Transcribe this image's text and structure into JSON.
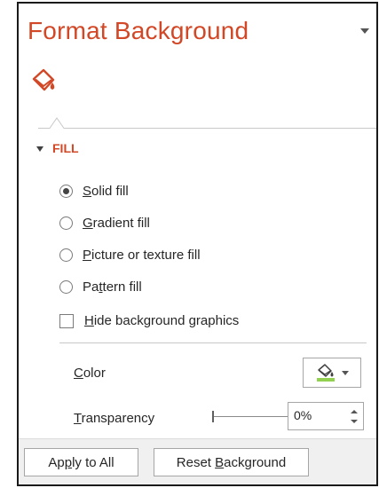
{
  "pane": {
    "title": "Format Background",
    "tab_icon": "paint-bucket-icon",
    "menu_icon": "dropdown-arrow-icon",
    "accent_color": "#d24726"
  },
  "fill_section": {
    "label": "FILL",
    "expanded": true,
    "options": [
      {
        "accel": "S",
        "rest": "olid fill",
        "selected": true
      },
      {
        "accel": "G",
        "rest": "radient fill",
        "selected": false
      },
      {
        "accel": "P",
        "rest": "icture or texture fill",
        "selected": false
      },
      {
        "pre": "Pa",
        "accel": "t",
        "rest": "tern fill",
        "selected": false
      }
    ],
    "hide_graphics": {
      "accel": "H",
      "rest": "ide background graphics",
      "checked": false
    }
  },
  "color": {
    "accel": "C",
    "rest": "olor",
    "swatch": "#92d050",
    "icon": "paint-bucket-icon"
  },
  "transparency": {
    "accel": "T",
    "rest": "ransparency",
    "value": "0%",
    "level": 0
  },
  "footer": {
    "apply": {
      "pre": "Ap",
      "accel": "p",
      "rest": "ly to All"
    },
    "reset": {
      "pre": "Reset ",
      "accel": "B",
      "rest": "ackground"
    }
  }
}
